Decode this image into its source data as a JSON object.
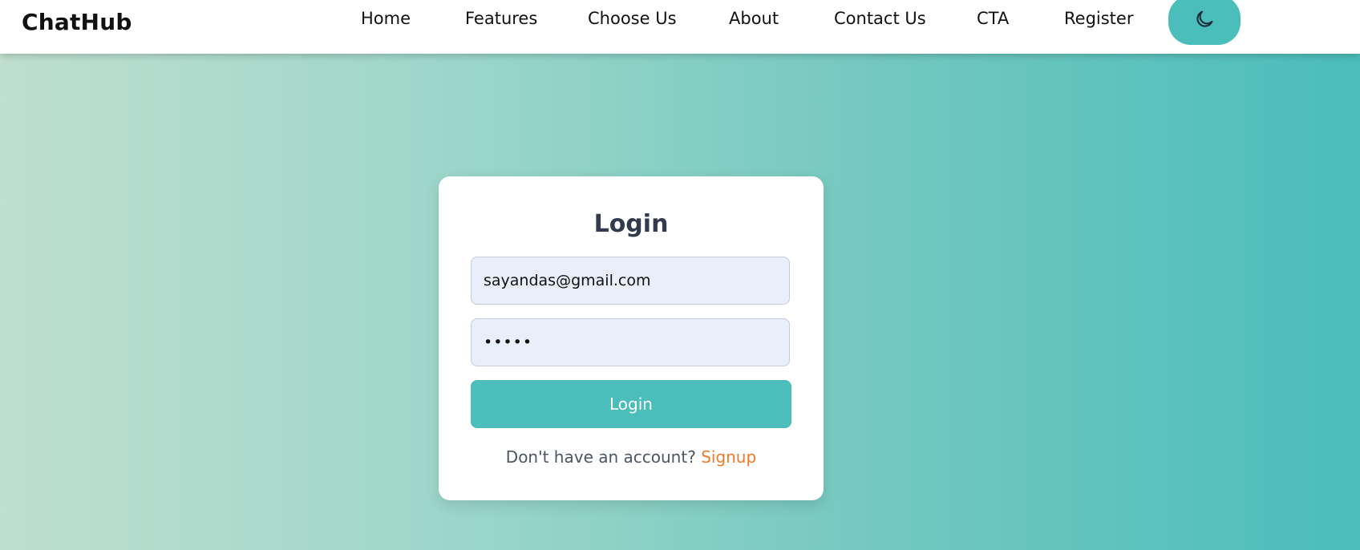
{
  "navbar": {
    "brand": "ChatHub",
    "links": [
      {
        "label": "Home"
      },
      {
        "label": "Features"
      },
      {
        "label": "Choose Us"
      },
      {
        "label": "About"
      },
      {
        "label": "Contact Us"
      },
      {
        "label": "CTA"
      },
      {
        "label": "Register"
      }
    ],
    "theme_toggle_icon": "moon-icon"
  },
  "login": {
    "title": "Login",
    "email_value": "sayandas@gmail.com",
    "password_value": "•••••",
    "button_label": "Login",
    "signup_prompt": "Don't have an account?",
    "signup_link": "Signup"
  },
  "colors": {
    "accent": "#4bbdbb",
    "link": "#f07a2a",
    "input_bg": "#e8eefa",
    "title": "#333c4e"
  }
}
